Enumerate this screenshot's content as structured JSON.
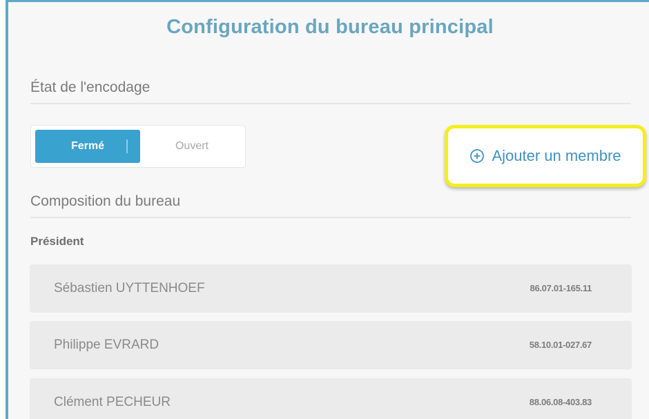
{
  "page": {
    "title": "Configuration du bureau principal"
  },
  "encoding_state": {
    "heading": "État de l'encodage",
    "options": [
      {
        "label": "Fermé",
        "selected": true
      },
      {
        "label": "Ouvert",
        "selected": false
      }
    ]
  },
  "add_member": {
    "label": "Ajouter un membre",
    "icon": "plus-circle-icon"
  },
  "composition": {
    "heading": "Composition du bureau",
    "role": "Président",
    "members": [
      {
        "name": "Sébastien UYTTENHOEF",
        "id": "86.07.01-165.11"
      },
      {
        "name": "Philippe EVRARD",
        "id": "58.10.01-027.67"
      },
      {
        "name": "Clément PECHEUR",
        "id": "88.06.08-403.83"
      }
    ]
  },
  "colors": {
    "title": "#6aa6be",
    "accent": "#3aa2ce",
    "highlight": "#f3ef1a",
    "link": "#3f92bf"
  }
}
